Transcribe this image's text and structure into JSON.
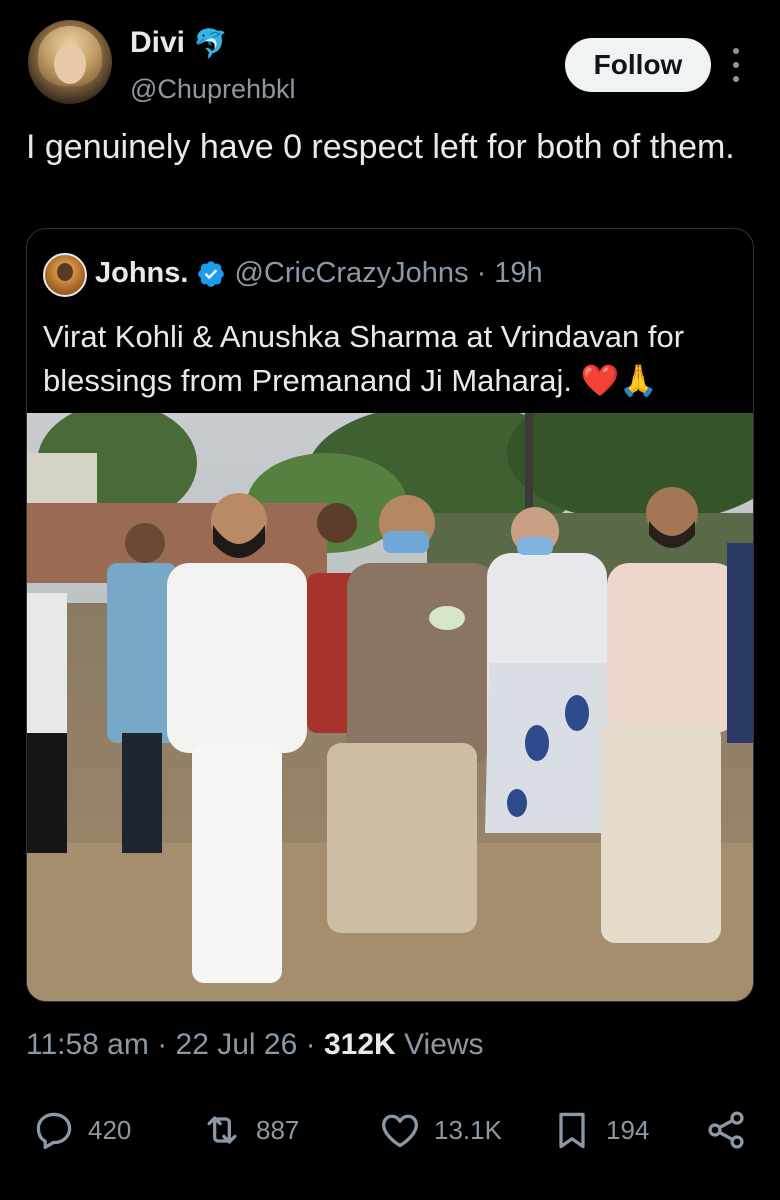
{
  "author": {
    "name": "Divi",
    "badge_emoji": "🐬",
    "handle": "@Chuprehbkl",
    "avatar_icon": "profile-photo"
  },
  "follow_label": "Follow",
  "tweet_text": "I genuinely have 0 respect left for both of them.",
  "quoted": {
    "name": "Johns.",
    "handle": "@CricCrazyJohns",
    "separator": "·",
    "time": "19h",
    "text": "Virat Kohli & Anushka Sharma at Vrindavan for blessings from Premanand Ji Maharaj.",
    "emojis": "❤️🙏"
  },
  "meta": {
    "time": "11:58 am",
    "date": "22 Jul 26",
    "views_count": "312K",
    "views_label": "Views",
    "separator": "·"
  },
  "actions": {
    "replies": "420",
    "reposts": "887",
    "likes": "13.1K",
    "bookmarks": "194"
  },
  "colors": {
    "background": "#000000",
    "text": "#e7e9ea",
    "muted": "#8b98a5",
    "verified": "#1d9bf0",
    "follow_bg": "#eff3f4"
  }
}
